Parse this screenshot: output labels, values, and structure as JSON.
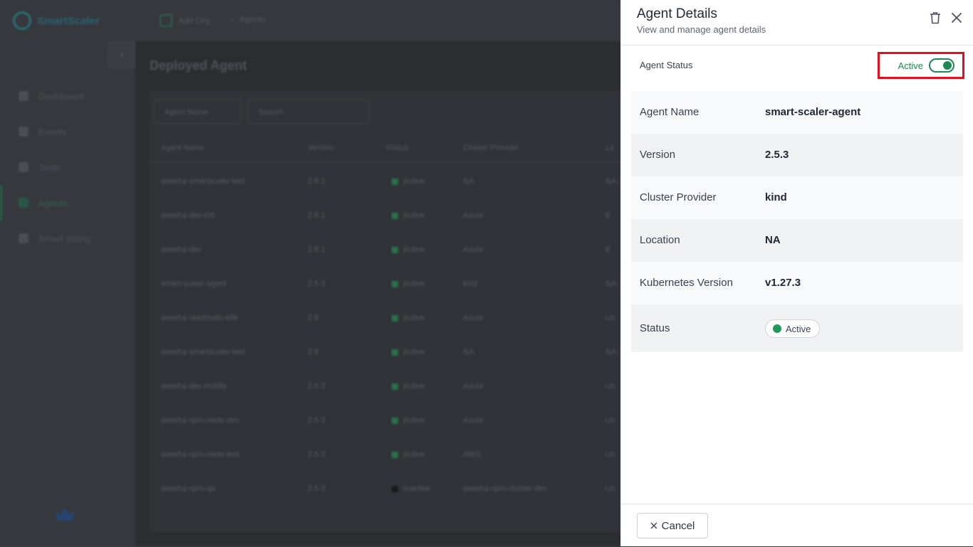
{
  "background": {
    "brand": "SmartScaler",
    "breadcrumb": [
      "Add Org",
      "Agents"
    ],
    "nav": [
      "Dashboard",
      "Events",
      "Tests",
      "Agents",
      "Smart Sizing"
    ],
    "active_nav": "Agents",
    "page_title": "Deployed Agent",
    "filters": {
      "agent_name": "Agent Name",
      "search": "Search"
    },
    "columns": [
      "Agent Name",
      "Version",
      "Status",
      "Cluster Provider",
      "Lo"
    ],
    "rows": [
      [
        "avesha-smartscaler-test",
        "2.6.1",
        "Active",
        "NA",
        "NA"
      ],
      [
        "avesha-dev-t05",
        "2.6.1",
        "Active",
        "Azure",
        "E"
      ],
      [
        "avesha-dev",
        "2.6.1",
        "Active",
        "Azure",
        "E"
      ],
      [
        "smart-scaler-agent",
        "2.5.3",
        "Active",
        "kind",
        "NA"
      ],
      [
        "avesha-readmatic-k8k",
        "2.6",
        "Active",
        "Azure",
        "Us"
      ],
      [
        "avesha-smartscaler-test",
        "2.6",
        "Active",
        "NA",
        "NA"
      ],
      [
        "avesha-dev-mobile",
        "2.5.3",
        "Active",
        "Azure",
        "Us"
      ],
      [
        "avesha-npm-node-dev",
        "2.5.3",
        "Active",
        "Azure",
        "Us"
      ],
      [
        "avesha-npm-node-test",
        "2.5.3",
        "Active",
        "AWS",
        "Us"
      ],
      [
        "avesha-npm-qa",
        "2.5.3",
        "Inactive",
        "avesha-npm-cluster-dev",
        "Us"
      ]
    ]
  },
  "drawer": {
    "title": "Agent Details",
    "subtitle": "View and manage agent details",
    "status_label": "Agent Status",
    "toggle_text": "Active",
    "toggle_on": true,
    "details": [
      {
        "label": "Agent Name",
        "value": "smart-scaler-agent"
      },
      {
        "label": "Version",
        "value": "2.5.3"
      },
      {
        "label": "Cluster Provider",
        "value": "kind"
      },
      {
        "label": "Location",
        "value": "NA"
      },
      {
        "label": "Kubernetes Version",
        "value": "v1.27.3"
      }
    ],
    "status_row": {
      "label": "Status",
      "badge": "Active"
    },
    "cancel_label": "Cancel"
  },
  "colors": {
    "accent_green": "#1d8a54",
    "highlight_red": "#e0111c",
    "overlay": "#3b3f44"
  }
}
